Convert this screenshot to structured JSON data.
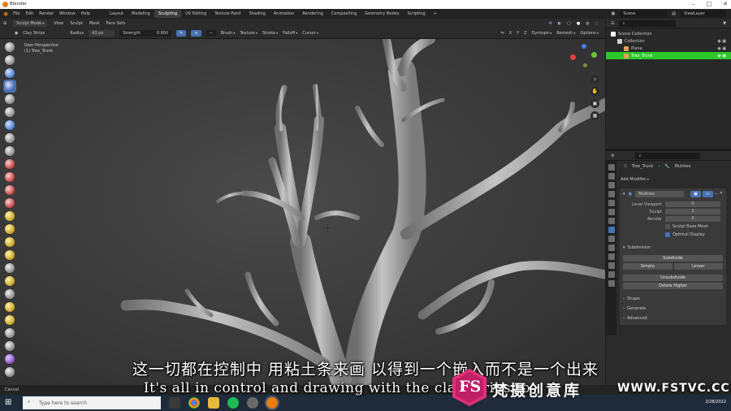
{
  "window": {
    "title": "Blender"
  },
  "menu": [
    "File",
    "Edit",
    "Render",
    "Window",
    "Help"
  ],
  "workspaces": [
    "Layout",
    "Modeling",
    "Sculpting",
    "UV Editing",
    "Texture Paint",
    "Shading",
    "Animation",
    "Rendering",
    "Compositing",
    "Geometry Nodes",
    "Scripting",
    "+"
  ],
  "active_workspace": "Sculpting",
  "scene": {
    "label": "Scene",
    "view_layer": "ViewLayer"
  },
  "header": {
    "mode": "Sculpt Mode",
    "menus": [
      "View",
      "Sculpt",
      "Mask",
      "Face Sets"
    ],
    "axes": [
      "X",
      "Y",
      "Z"
    ],
    "dyntopo": "Dyntopo",
    "remesh": "Remesh",
    "options": "Options"
  },
  "toolbar": {
    "brush": "Clay Strips",
    "radius_label": "Radius",
    "radius_value": "43 px",
    "strength_label": "Strength",
    "strength_value": "0.600",
    "menus": [
      "Brush",
      "Texture",
      "Stroke",
      "Falloff",
      "Cursor"
    ]
  },
  "viewport": {
    "line1": "User Perspective",
    "line2": "(1) Tree_Trunk"
  },
  "gizmo": {
    "x": "X",
    "y": "Y",
    "z": "Z"
  },
  "outliner": {
    "rows": [
      {
        "label": "Scene Collection",
        "indent": 0
      },
      {
        "label": "Collection",
        "indent": 1
      },
      {
        "label": "Plane",
        "indent": 2
      },
      {
        "label": "Tree_Trunk",
        "indent": 2,
        "selected": true
      }
    ]
  },
  "properties": {
    "object": "Tree_Trunk",
    "modifier_crumb": "Multires",
    "add_modifier": "Add Modifier",
    "modifier_name": "Multires",
    "level_viewport_label": "Level Viewport",
    "level_viewport_value": "0",
    "sculpt_label": "Sculpt",
    "sculpt_value": "2",
    "render_label": "Render",
    "render_value": "2",
    "sculpt_base_mesh": "Sculpt Base Mesh",
    "optimal_display": "Optimal Display",
    "subdivision_section": "Subdivision",
    "subdivide": "Subdivide",
    "simple": "Simple",
    "linear": "Linear",
    "unsubdivide": "Unsubdivide",
    "delete_higher": "Delete Higher",
    "panels": [
      "Shape",
      "Generate",
      "Advanced"
    ]
  },
  "status": {
    "left": "Cancel",
    "date": "2/28/2022"
  },
  "taskbar": {
    "search_placeholder": "Type here to search"
  },
  "subtitles": {
    "chinese": "这一切都在控制中 用粘土条来画 以得到一个嵌入而不是一个出来",
    "english": "It's all in control and drawing with the clay strips to"
  },
  "watermark": {
    "logo_text": "FS",
    "brand": "梵摄创意库",
    "url": "WWW.FSTVC.CC"
  },
  "colors": {
    "accent": "#4772b3",
    "selected_row": "#2bc82b",
    "blender_orange": "#e87d0d",
    "watermark_pink": "#e0307a"
  }
}
